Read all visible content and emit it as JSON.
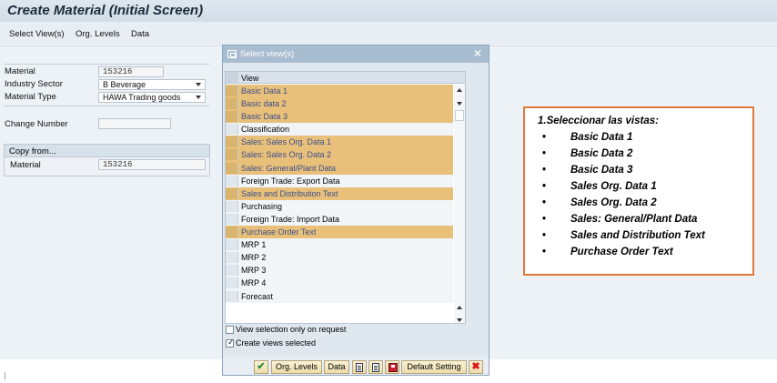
{
  "window": {
    "title": "Create Material (Initial Screen)"
  },
  "menu": {
    "items": [
      "Select View(s)",
      "Org. Levels",
      "Data"
    ]
  },
  "form": {
    "material_label": "Material",
    "material_value": "153216",
    "industry_sector_label": "Industry Sector",
    "industry_sector_value": "B Beverage",
    "material_type_label": "Material Type",
    "material_type_value": "HAWA Trading goods",
    "change_number_label": "Change Number",
    "change_number_value": "",
    "copy_from_title": "Copy from...",
    "copy_material_label": "Material",
    "copy_material_value": "153216"
  },
  "dialog": {
    "title": "Select view(s)",
    "column_header": "View",
    "views": [
      {
        "label": "Basic Data 1",
        "selected": true
      },
      {
        "label": "Basic data 2",
        "selected": true
      },
      {
        "label": "Basic Data 3",
        "selected": true
      },
      {
        "label": "Classification",
        "selected": false
      },
      {
        "label": "Sales: Sales Org. Data 1",
        "selected": true
      },
      {
        "label": "Sales: Sales Org. Data 2",
        "selected": true
      },
      {
        "label": "Sales: General/Plant Data",
        "selected": true
      },
      {
        "label": "Foreign Trade: Export Data",
        "selected": false
      },
      {
        "label": "Sales and Distribution Text",
        "selected": true
      },
      {
        "label": "Purchasing",
        "selected": false
      },
      {
        "label": "Foreign Trade: Import Data",
        "selected": false
      },
      {
        "label": "Purchase Order Text",
        "selected": true
      },
      {
        "label": "MRP 1",
        "selected": false
      },
      {
        "label": "MRP 2",
        "selected": false
      },
      {
        "label": "MRP 3",
        "selected": false
      },
      {
        "label": "MRP 4",
        "selected": false
      },
      {
        "label": "Forecast",
        "selected": false
      }
    ],
    "option_request_label": "View selection only on request",
    "option_request_checked": false,
    "option_create_label": "Create views selected",
    "option_create_checked": true,
    "buttons": {
      "org_levels": "Org. Levels",
      "data": "Data",
      "default_setting": "Default Setting"
    }
  },
  "note": {
    "title": "1.Seleccionar las vistas:",
    "bullet": "•",
    "items": [
      "Basic Data 1",
      "Basic Data 2",
      "Basic Data 3",
      "Sales Org. Data 1",
      "Sales Org. Data 2",
      "Sales: General/Plant Data",
      "Sales and Distribution Text",
      "Purchase Order Text"
    ]
  },
  "colors": {
    "selected_row": "#e8c07a",
    "note_border": "#e07a3a",
    "dialog_title": "#a9bdd1"
  }
}
